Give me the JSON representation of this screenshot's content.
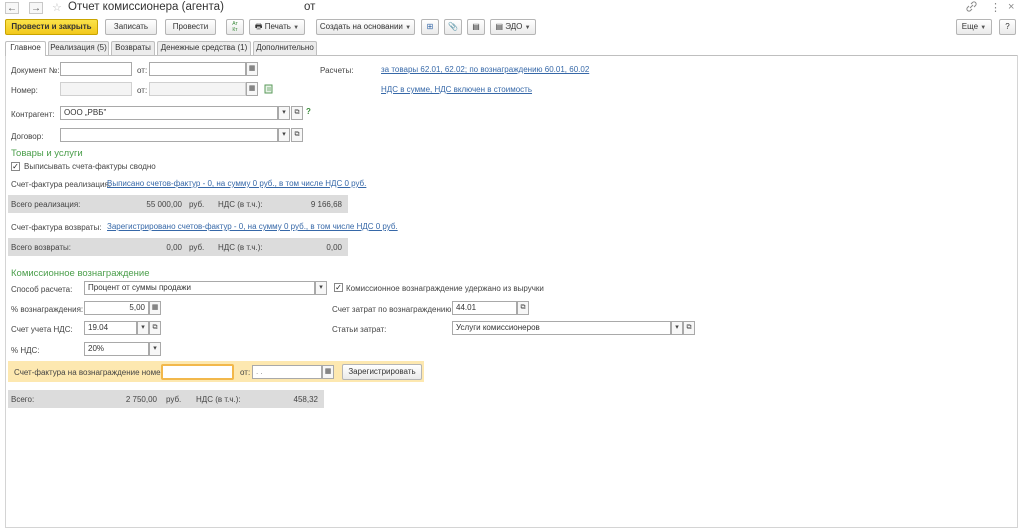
{
  "window": {
    "back_icon": "←",
    "forward_icon": "→",
    "star_icon": "☆",
    "title": "Отчет комиссионера (агента)",
    "title_suffix": "от",
    "link_icon": "🔗",
    "more_icon": "⋮",
    "close_icon": "×"
  },
  "toolbar": {
    "post_and_close": "Провести и закрыть",
    "write": "Записать",
    "post": "Провести",
    "dt_kt": "Ат Кт",
    "print": "Печать",
    "create_based_on": "Создать на основании",
    "edo": "ЭДО",
    "more": "Еще",
    "help": "?"
  },
  "tabs": [
    "Главное",
    "Реализация (5)",
    "Возвраты",
    "Денежные средства (1)",
    "Дополнительно"
  ],
  "header": {
    "doc_no_label": "Документ №:",
    "doc_no_value": "",
    "from_label": "от:",
    "doc_date_value": "",
    "number_label": "Номер:",
    "number_value": "",
    "number_date_value": "",
    "settlements_label": "Расчеты:",
    "settlements_link": "за товары 62.01, 62.02; по вознаграждению 60.01, 60.02",
    "vat_link": "НДС в сумме, НДС включен в стоимость",
    "counterparty_label": "Контрагент:",
    "counterparty_value": "ООО „РВБ\"",
    "help_mark": "?",
    "contract_label": "Договор:",
    "contract_value": ""
  },
  "goods": {
    "section_title": "Товары и услуги",
    "summary_invoices_label": "Выписывать счета-фактуры сводно",
    "summary_invoices_checked": "✓",
    "sales_invoice_label": "Счет-фактура реализация:",
    "sales_invoice_link": "Выписано счетов-фактур - 0, на сумму 0 руб., в том числе НДС 0 руб.",
    "sales_total_label": "Всего реализация:",
    "sales_total": "55 000,00",
    "currency": "руб.",
    "vat_incl_label": "НДС (в т.ч.):",
    "sales_vat": "9 166,68",
    "returns_invoice_label": "Счет-фактура возвраты:",
    "returns_invoice_link": "Зарегистрировано счетов-фактур - 0, на сумму 0 руб., в том числе НДС 0 руб.",
    "returns_total_label": "Всего возвраты:",
    "returns_total": "0,00",
    "returns_vat": "0,00"
  },
  "commission": {
    "section_title": "Комиссионное вознаграждение",
    "method_label": "Способ расчета:",
    "method_value": "Процент от суммы продажи",
    "withheld_label": "Комиссионное вознаграждение удержано из выручки",
    "withheld_checked": "✓",
    "percent_label": "% вознаграждения:",
    "percent_value": "5,00",
    "expense_account_label": "Счет затрат по вознаграждению:",
    "expense_account_value": "44.01",
    "vat_account_label": "Счет учета НДС:",
    "vat_account_value": "19.04",
    "expense_items_label": "Статьи затрат:",
    "expense_items_value": "Услуги комиссионеров",
    "vat_rate_label": "% НДС:",
    "vat_rate_value": "20%",
    "invoice_label": "Счет-фактура на вознаграждение номер:",
    "invoice_number_value": "",
    "invoice_from_label": "от:",
    "invoice_date_placeholder": ". .",
    "register_button": "Зарегистрировать",
    "total_label": "Всего:",
    "total_value": "2 750,00",
    "currency": "руб.",
    "vat_incl_label": "НДС (в т.ч.):",
    "total_vat": "458,32"
  },
  "icons": {
    "calendar": "▦",
    "dropdown": "▾",
    "open": "⧉",
    "print": "🖶",
    "clip": "📎",
    "table": "▤",
    "struct": "⊞",
    "edo": "▤"
  }
}
